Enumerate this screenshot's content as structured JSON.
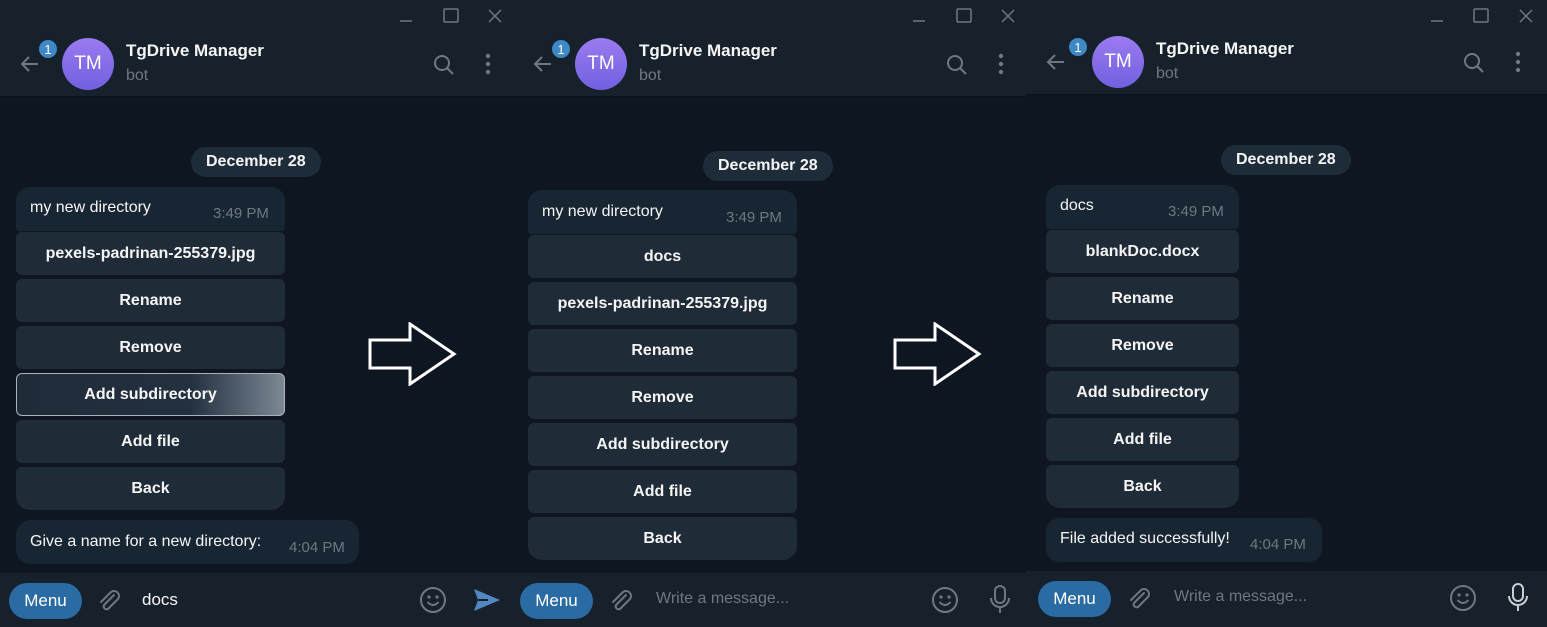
{
  "window_controls": [
    "minimize-icon",
    "maximize-icon",
    "close-icon"
  ],
  "panels": [
    {
      "chat": {
        "avatar_initials": "TM",
        "badge": "1",
        "name": "TgDrive Manager",
        "status": "bot"
      },
      "date": "December 28",
      "message": {
        "text": "my new directory",
        "time": "3:49 PM"
      },
      "buttons": [
        "pexels-padrinan-255379.jpg",
        "Rename",
        "Remove",
        "Add subdirectory",
        "Add file",
        "Back"
      ],
      "reply": {
        "text": "Give a name for a new directory:",
        "time": "4:04 PM"
      },
      "composer": {
        "menu": "Menu",
        "value": "docs",
        "placeholder": "Write a message..."
      }
    },
    {
      "chat": {
        "avatar_initials": "TM",
        "badge": "1",
        "name": "TgDrive Manager",
        "status": "bot"
      },
      "date": "December 28",
      "message": {
        "text": "my new directory",
        "time": "3:49 PM"
      },
      "buttons": [
        "docs",
        "pexels-padrinan-255379.jpg",
        "Rename",
        "Remove",
        "Add subdirectory",
        "Add file",
        "Back"
      ],
      "composer": {
        "menu": "Menu",
        "value": "",
        "placeholder": "Write a message..."
      }
    },
    {
      "chat": {
        "avatar_initials": "TM",
        "badge": "1",
        "name": "TgDrive Manager",
        "status": "bot"
      },
      "date": "December 28",
      "message": {
        "text": "docs",
        "time": "3:49 PM"
      },
      "buttons": [
        "blankDoc.docx",
        "Rename",
        "Remove",
        "Add subdirectory",
        "Add file",
        "Back"
      ],
      "reply": {
        "text": "File added successfully!",
        "time": "4:04 PM"
      },
      "composer": {
        "menu": "Menu",
        "value": "",
        "placeholder": "Write a message..."
      }
    }
  ],
  "colors": {
    "background": "#0e1621",
    "header": "#17212b",
    "bubble": "#182533",
    "button": "#202b38",
    "accent": "#2b6ba4",
    "muted": "#6d7883"
  },
  "icons": [
    "back-arrow-icon",
    "search-icon",
    "more-vertical-icon",
    "paperclip-icon",
    "emoji-icon",
    "send-icon",
    "microphone-icon",
    "right-arrow-icon"
  ]
}
